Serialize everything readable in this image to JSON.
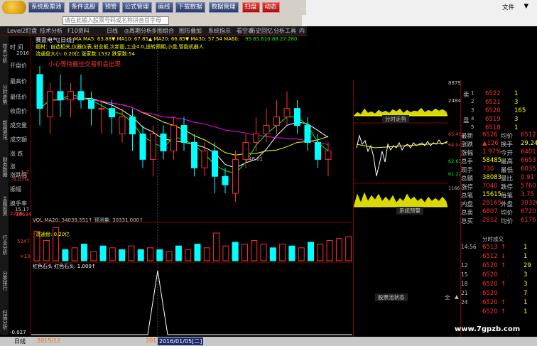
{
  "menu": {
    "buttons": [
      "系统股票池",
      "条件选股",
      "预警",
      "公式管理",
      "画线",
      "下载数据",
      "数据管理",
      "扫盘",
      "动态"
    ],
    "right_items": [
      "文件",
      "▼"
    ]
  },
  "search": {
    "placeholder": "请在此输入股票号码或名称拼音首字母"
  },
  "toolbar": {
    "items": [
      "Level2盯盘",
      "技术分析",
      "F10资料",
      "日线",
      "◎周期分析",
      "多图组合",
      "图形叠加",
      "系统指示",
      "看空表",
      "历史回忆",
      "分析工具",
      "内"
    ]
  },
  "left_panel": {
    "labels": [
      "时 间",
      "开盘价",
      "最高价",
      "最低价",
      "收盘价",
      "成交量",
      "成交额",
      "涨 跌",
      "涨跌幅",
      "振幅",
      "换手率"
    ],
    "values": [
      "2016",
      "",
      "",
      "",
      "",
      "",
      "",
      "",
      "",
      "",
      ""
    ],
    "extra": [
      "涨",
      "5.7",
      "-5.07%",
      "15.17"
    ]
  },
  "vtabs": [
    "技术分析",
    "分时走势",
    "新闻资讯",
    "财务数据",
    "主题投资",
    "行业分析",
    "分类排行",
    "扫描分析"
  ],
  "chart": {
    "title": "赛意电气[日线]",
    "ma_line": "MA  MA5: 63.88▼  MA10: 67.85▲  MA20: 66.85▼  MA30: 57.54  MA60:",
    "ma_right": "95  85.610  88  27.280",
    "info1": "题材：自选相关,仪器仪表,创业板,次新股,工业4.0,送转预期,小盘,智能机器人",
    "info2": "流通盘大小: 0.20亿   涨家数:1532   跌家数:54",
    "signal": "小心等待最佳交易机会出现",
    "low_label": "48.01",
    "vol_title": "VOL  MA20: 34039.551↑   预测量: 30331.000↑",
    "vol_note": "流通盘: 0.20亿",
    "vol_scale": [
      "10694",
      "5347",
      "×10"
    ],
    "ind_title": "红色石头   红色石头: 1.000↑",
    "ind_bottom": "-0.027",
    "axis_left": "2228",
    "date_label": "2016/01/05[二]",
    "date_start": "2015/12",
    "date_mid": "201"
  },
  "mini_chart": {
    "label1": "分时走势",
    "label2": "系统预警",
    "label3": "股票池状态",
    "y1": [
      "8879",
      "2484"
    ],
    "prices": [
      "65.45",
      "64.04",
      "62.63",
      "61.22"
    ],
    "vol": "1166"
  },
  "order_book": {
    "asks": [
      {
        "label": "卖",
        "price": "6522",
        "vol": "1"
      },
      {
        "label": "",
        "price": "6521",
        "vol": "3"
      },
      {
        "label": "",
        "price": "6520",
        "vol": "165"
      },
      {
        "label": "盘",
        "price": "6519",
        "vol": "3"
      },
      {
        "label": "",
        "price": "6518",
        "vol": "1"
      }
    ]
  },
  "stats": [
    {
      "a": "最新",
      "b": "6526",
      "c": "均价",
      "d": "6512"
    },
    {
      "a": "涨跌",
      "b": "▲126",
      "c": "换手",
      "d": "29.24%"
    },
    {
      "a": "涨幅",
      "b": "1.97%",
      "c": "今开",
      "d": "6401"
    },
    {
      "a": "总手",
      "b": "58485",
      "c": "最高",
      "d": "6653"
    },
    {
      "a": "现手",
      "b": "730",
      "c": "最低",
      "d": "6035"
    },
    {
      "a": "总额",
      "b": "38083",
      "c": "量比",
      "d": "0.91"
    },
    {
      "a": "涨停",
      "b": "7040",
      "c": "跌停",
      "d": "5760"
    },
    {
      "a": "总笔",
      "b": "15615",
      "c": "每笔",
      "d": "3.75"
    },
    {
      "a": "内盘",
      "b": "28165",
      "c": "外盘",
      "d": "30320"
    },
    {
      "a": "总卖",
      "b": "6807",
      "c": "均价",
      "d": "6720"
    },
    {
      "a": "总买",
      "b": "2812",
      "c": "均价",
      "d": "6176"
    }
  ],
  "ticks_header": "分时成交",
  "ticks": [
    {
      "t": "14:56",
      "p": "6513",
      "arrow": "↑",
      "v": "1"
    },
    {
      "t": "",
      "p": "6512",
      "arrow": "↓",
      "v": "1"
    },
    {
      "t": "12",
      "p": "6520",
      "arrow": "↑",
      "v": "29"
    },
    {
      "t": "15",
      "p": "6520",
      "arrow": "",
      "v": "3"
    },
    {
      "t": "18",
      "p": "6520",
      "arrow": "↑",
      "v": "3"
    },
    {
      "t": "21",
      "p": "6520",
      "arrow": "",
      "v": "7"
    },
    {
      "t": "24",
      "p": "6520",
      "arrow": "↑",
      "v": "1"
    },
    {
      "t": "",
      "p": "6520",
      "arrow": "↑",
      "v": "1"
    }
  ],
  "bottom": {
    "left": "日线",
    "right": "www.7gpzb.com",
    "items": [
      "全",
      "▲"
    ]
  },
  "colors": {
    "up": "#ff3030",
    "down": "#00ffff",
    "ma5": "#ffffff",
    "ma10": "#ffff00",
    "ma20": "#ff00ff",
    "ma30": "#00ff00",
    "ma60": "#c0c0c0"
  },
  "chart_data": {
    "type": "candlestick",
    "candles": [
      {
        "o": 62,
        "c": 58,
        "h": 63,
        "l": 56
      },
      {
        "o": 57,
        "c": 60,
        "h": 61,
        "l": 55
      },
      {
        "o": 60,
        "c": 59,
        "h": 62,
        "l": 57
      },
      {
        "o": 59,
        "c": 60,
        "h": 61,
        "l": 57
      },
      {
        "o": 60,
        "c": 59,
        "h": 62,
        "l": 58
      },
      {
        "o": 59,
        "c": 58,
        "h": 60,
        "l": 56
      },
      {
        "o": 58,
        "c": 58,
        "h": 59,
        "l": 55
      },
      {
        "o": 58,
        "c": 57,
        "h": 59,
        "l": 55
      },
      {
        "o": 55,
        "c": 57,
        "h": 58,
        "l": 54
      },
      {
        "o": 57,
        "c": 55,
        "h": 58,
        "l": 53
      },
      {
        "o": 55,
        "c": 52,
        "h": 56,
        "l": 51
      },
      {
        "o": 52,
        "c": 55,
        "h": 56,
        "l": 50
      },
      {
        "o": 55,
        "c": 53,
        "h": 56,
        "l": 52
      },
      {
        "o": 53,
        "c": 56,
        "h": 57,
        "l": 52
      },
      {
        "o": 56,
        "c": 54,
        "h": 57,
        "l": 53
      },
      {
        "o": 54,
        "c": 51,
        "h": 55,
        "l": 50
      },
      {
        "o": 51,
        "c": 53,
        "h": 54,
        "l": 50
      },
      {
        "o": 53,
        "c": 50,
        "h": 54,
        "l": 48
      },
      {
        "o": 50,
        "c": 49,
        "h": 51,
        "l": 48
      },
      {
        "o": 48,
        "c": 52,
        "h": 53,
        "l": 47
      },
      {
        "o": 52,
        "c": 54,
        "h": 55,
        "l": 51
      },
      {
        "o": 54,
        "c": 55,
        "h": 57,
        "l": 53
      },
      {
        "o": 55,
        "c": 56,
        "h": 58,
        "l": 54
      },
      {
        "o": 56,
        "c": 57,
        "h": 59,
        "l": 55
      },
      {
        "o": 57,
        "c": 58,
        "h": 60,
        "l": 56
      },
      {
        "o": 58,
        "c": 56,
        "h": 59,
        "l": 55
      },
      {
        "o": 56,
        "c": 54,
        "h": 57,
        "l": 53
      },
      {
        "o": 54,
        "c": 52,
        "h": 55,
        "l": 51
      },
      {
        "o": 52,
        "c": 53,
        "h": 54,
        "l": 50
      }
    ],
    "volume": [
      80,
      55,
      90,
      30,
      35,
      45,
      25,
      40,
      35,
      30,
      40,
      30,
      35,
      30,
      25,
      40,
      30,
      45,
      35,
      75,
      40,
      50,
      45,
      55,
      45,
      35,
      45,
      40,
      35,
      50,
      45,
      55,
      60,
      65
    ],
    "indicator_peak_index": 18
  }
}
